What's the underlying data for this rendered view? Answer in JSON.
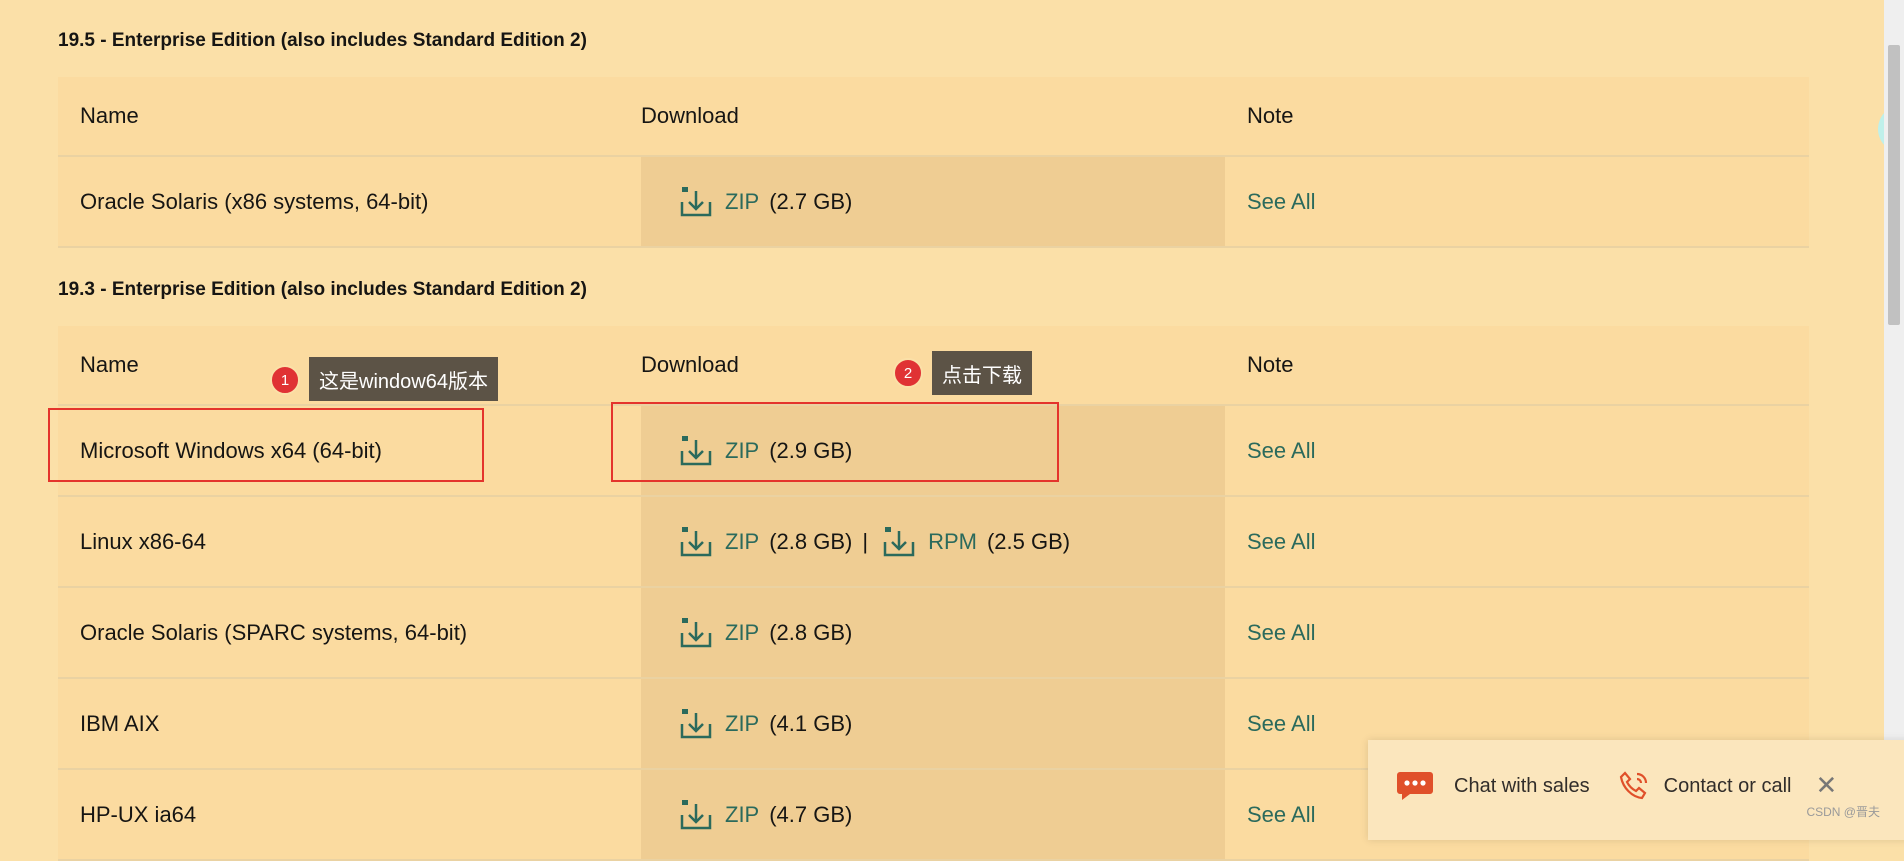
{
  "sections": [
    {
      "title": "19.5 - Enterprise Edition (also includes Standard Edition 2)",
      "headers": {
        "name": "Name",
        "download": "Download",
        "note": "Note"
      },
      "rows": [
        {
          "name": "Oracle Solaris (x86 systems, 64-bit)",
          "downloads": [
            {
              "type": "ZIP",
              "size": "(2.7 GB)"
            }
          ],
          "note": "See All"
        }
      ]
    },
    {
      "title": "19.3 - Enterprise Edition (also includes Standard Edition 2)",
      "headers": {
        "name": "Name",
        "download": "Download",
        "note": "Note"
      },
      "rows": [
        {
          "name": "Microsoft Windows x64 (64-bit)",
          "downloads": [
            {
              "type": "ZIP",
              "size": "(2.9 GB)"
            }
          ],
          "note": "See All"
        },
        {
          "name": "Linux x86-64",
          "downloads": [
            {
              "type": "ZIP",
              "size": "(2.8 GB)"
            },
            {
              "type": "RPM",
              "size": "(2.5 GB)"
            }
          ],
          "separator": "|",
          "note": "See All"
        },
        {
          "name": "Oracle Solaris (SPARC systems, 64-bit)",
          "downloads": [
            {
              "type": "ZIP",
              "size": "(2.8 GB)"
            }
          ],
          "note": "See All"
        },
        {
          "name": "IBM AIX",
          "downloads": [
            {
              "type": "ZIP",
              "size": "(4.1 GB)"
            }
          ],
          "note": "See All"
        },
        {
          "name": "HP-UX ia64",
          "downloads": [
            {
              "type": "ZIP",
              "size": "(4.7 GB)"
            }
          ],
          "note": "See All"
        }
      ]
    }
  ],
  "annotations": [
    {
      "number": "1",
      "text": "这是window64版本"
    },
    {
      "number": "2",
      "text": "点击下载"
    }
  ],
  "chat": {
    "chat_label": "Chat with sales",
    "contact_label": "Contact or call",
    "close": "✕"
  },
  "watermark": "CSDN @晋夫",
  "colors": {
    "link": "#2b6a5c",
    "highlight": "#e4342c",
    "chat_icon": "#e0502a"
  }
}
